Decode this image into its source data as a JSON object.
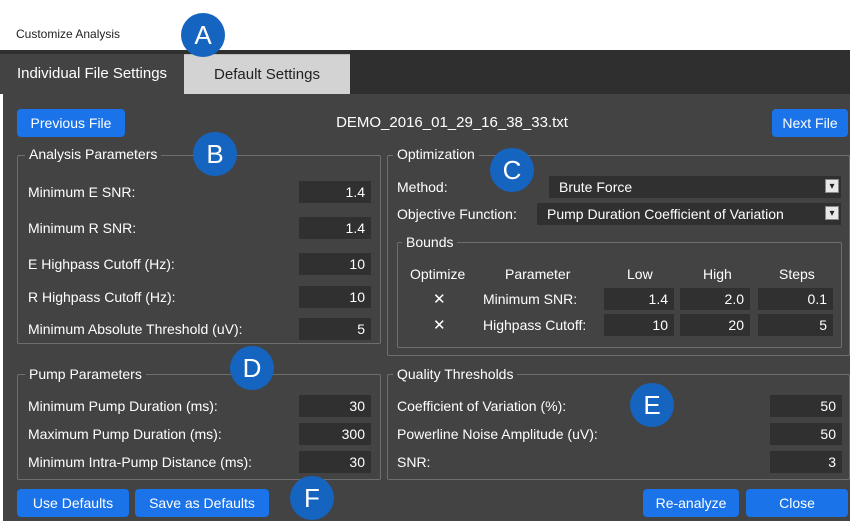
{
  "window": {
    "title": "Customize Analysis"
  },
  "tabs": [
    {
      "label": "Individual File Settings"
    },
    {
      "label": "Default Settings"
    }
  ],
  "nav": {
    "previous": "Previous File",
    "filename": "DEMO_2016_01_29_16_38_33.txt",
    "next": "Next File"
  },
  "analysis": {
    "title": "Analysis Parameters",
    "rows": [
      {
        "label": "Minimum E SNR:",
        "value": "1.4"
      },
      {
        "label": "Minimum R SNR:",
        "value": "1.4"
      },
      {
        "label": "E Highpass Cutoff (Hz):",
        "value": "10"
      },
      {
        "label": "R Highpass Cutoff (Hz):",
        "value": "10"
      },
      {
        "label": "Minimum Absolute Threshold (uV):",
        "value": "5"
      }
    ]
  },
  "optimization": {
    "title": "Optimization",
    "method_label": "Method:",
    "method_value": "Brute Force",
    "objective_label": "Objective Function:",
    "objective_value": "Pump Duration Coefficient of Variation",
    "bounds": {
      "title": "Bounds",
      "headers": [
        "Optimize",
        "Parameter",
        "Low",
        "High",
        "Steps"
      ],
      "rows": [
        {
          "check": "✕",
          "parameter": "Minimum SNR:",
          "low": "1.4",
          "high": "2.0",
          "steps": "0.1"
        },
        {
          "check": "✕",
          "parameter": "Highpass Cutoff:",
          "low": "10",
          "high": "20",
          "steps": "5"
        }
      ]
    }
  },
  "pump": {
    "title": "Pump Parameters",
    "rows": [
      {
        "label": "Minimum Pump Duration (ms):",
        "value": "30"
      },
      {
        "label": "Maximum Pump Duration (ms):",
        "value": "300"
      },
      {
        "label": "Minimum Intra-Pump Distance (ms):",
        "value": "30"
      }
    ]
  },
  "quality": {
    "title": "Quality Thresholds",
    "rows": [
      {
        "label": "Coefficient of Variation (%):",
        "value": "50"
      },
      {
        "label": "Powerline Noise Amplitude (uV):",
        "value": "50"
      },
      {
        "label": "SNR:",
        "value": "3"
      }
    ]
  },
  "footer": {
    "use_defaults": "Use Defaults",
    "save_defaults": "Save as Defaults",
    "reanalyze": "Re-analyze",
    "close": "Close"
  },
  "callouts": [
    "A",
    "B",
    "C",
    "D",
    "E",
    "F"
  ],
  "colors": {
    "accent": "#1a73e8",
    "panel": "#434343",
    "field": "#303030",
    "callout": "#1565c0"
  }
}
